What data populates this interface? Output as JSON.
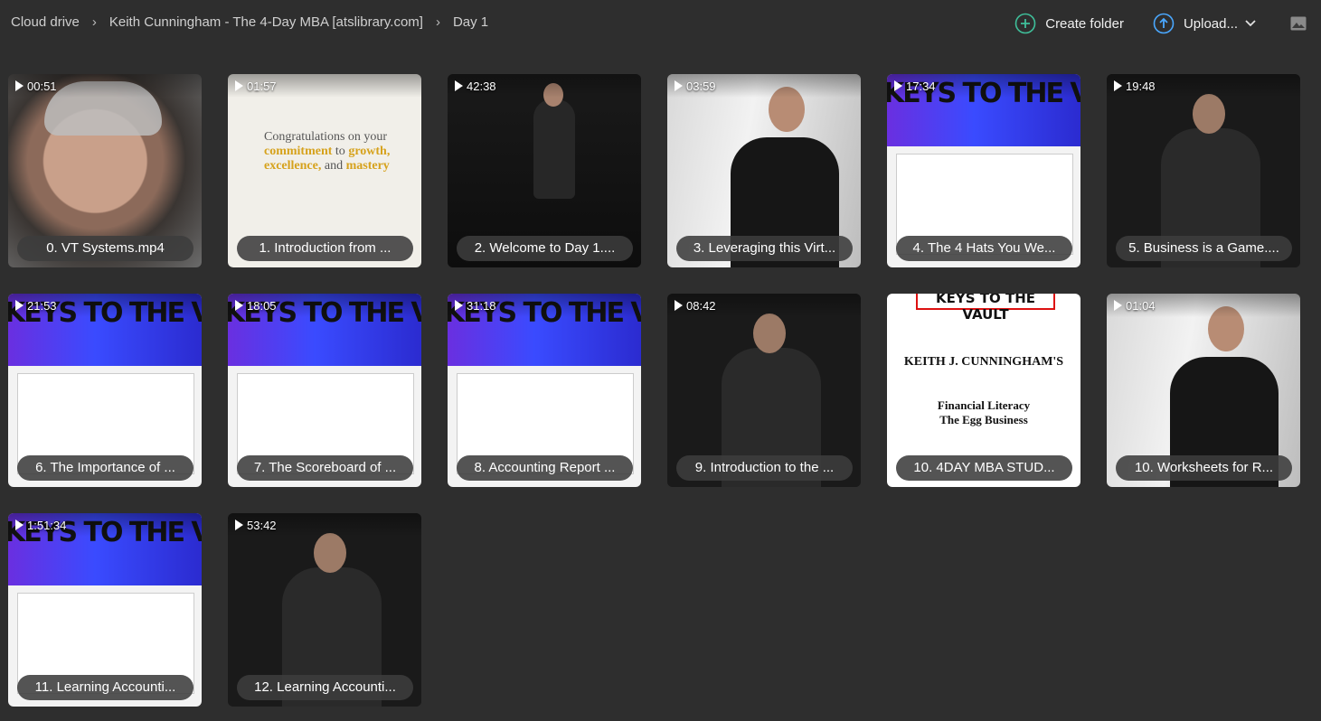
{
  "breadcrumb": [
    "Cloud drive",
    "Keith Cunningham - The 4-Day MBA [atslibrary.com]",
    "Day 1"
  ],
  "toolbar": {
    "create_folder": "Create folder",
    "upload": "Upload..."
  },
  "files": [
    {
      "duration": "00:51",
      "name": "0. VT Systems.mp4",
      "thumb": "face"
    },
    {
      "duration": "01:57",
      "name": "1. Introduction from ...",
      "thumb": "cream"
    },
    {
      "duration": "42:38",
      "name": "2. Welcome to Day 1....",
      "thumb": "stage"
    },
    {
      "duration": "03:59",
      "name": "3. Leveraging this Virt...",
      "thumb": "white"
    },
    {
      "duration": "17:34",
      "name": "4. The 4 Hats You We...",
      "thumb": "vault"
    },
    {
      "duration": "19:48",
      "name": "5. Business is a Game....",
      "thumb": "dark"
    },
    {
      "duration": "21:53",
      "name": "6. The Importance of ...",
      "thumb": "vault"
    },
    {
      "duration": "18:05",
      "name": "7. The Scoreboard of ...",
      "thumb": "vault"
    },
    {
      "duration": "31:18",
      "name": "8. Accounting Report ...",
      "thumb": "vault"
    },
    {
      "duration": "08:42",
      "name": "9. Introduction to the ...",
      "thumb": "dark"
    },
    {
      "duration": "",
      "name": "10. 4DAY MBA STUD...",
      "thumb": "doc"
    },
    {
      "duration": "01:04",
      "name": "10. Worksheets for R...",
      "thumb": "white"
    },
    {
      "duration": "1:51:34",
      "name": "11. Learning Accounti...",
      "thumb": "vault"
    },
    {
      "duration": "53:42",
      "name": "12. Learning Accounti...",
      "thumb": "dark"
    }
  ],
  "thumb_text": {
    "cream": [
      "Congratulations on your",
      "commitment",
      "to",
      "growth,",
      "excellence,",
      "and",
      "mastery"
    ],
    "vault": "KEYS TO THE VAULT",
    "doc_header": "KEYS TO THE VAULT",
    "doc_title": "KEITH J. CUNNINGHAM'S",
    "doc_sub": [
      "Financial Literacy",
      "The Egg Business"
    ]
  }
}
